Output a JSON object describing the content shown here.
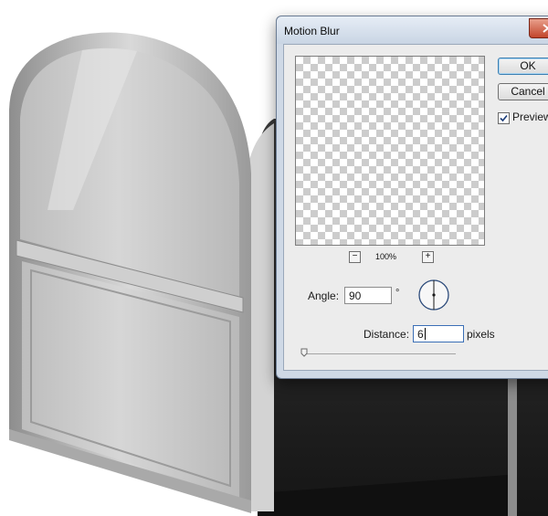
{
  "dialog": {
    "title": "Motion Blur",
    "buttons": {
      "ok": "OK",
      "cancel": "Cancel"
    },
    "preview": {
      "label": "Preview",
      "checked": true
    },
    "zoom": {
      "minus": "−",
      "plus": "+",
      "level": "100%"
    },
    "angle": {
      "label": "Angle:",
      "value": "90",
      "unit": "°"
    },
    "distance": {
      "label": "Distance:",
      "value": "6",
      "unit": "pixels"
    }
  },
  "colors": {
    "title_bar": "#cfd9e6",
    "close_button": "#c2452b",
    "door_light": "#d0d0d0",
    "door_frame": "#b5b5b5",
    "building_dark": "#1f1f1f"
  },
  "icons": {
    "close": "close-icon",
    "check": "check-icon",
    "angle_dial": "angle-dial-icon",
    "slider": "slider-thumb-icon"
  }
}
